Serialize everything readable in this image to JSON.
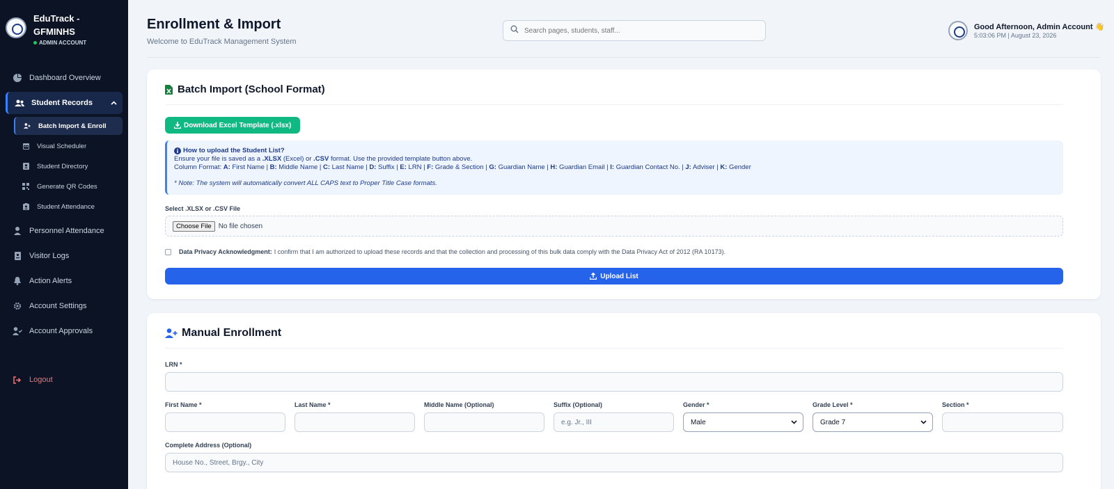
{
  "sidebar": {
    "brand_line1": "EduTrack -",
    "brand_line2": "GFMINHS",
    "role": "ADMIN ACCOUNT",
    "items": {
      "dashboard": "Dashboard Overview",
      "student_records": "Student Records",
      "personnel": "Personnel Attendance",
      "visitor": "Visitor Logs",
      "alerts": "Action Alerts",
      "settings": "Account Settings",
      "approvals": "Account Approvals",
      "logout": "Logout"
    },
    "sub_items": {
      "batch": "Batch Import & Enroll",
      "scheduler": "Visual Scheduler",
      "directory": "Student Directory",
      "qr": "Generate QR Codes",
      "attendance": "Student Attendance"
    }
  },
  "header": {
    "title": "Enrollment & Import",
    "subtitle": "Welcome to EduTrack Management System",
    "search_placeholder": "Search pages, students, staff...",
    "greeting": "Good Afternoon, Admin Account 👋",
    "datetime": "5:03:06 PM | August 23, 2026"
  },
  "batch": {
    "title": "Batch Import (School Format)",
    "download_label": "Download Excel Template (.xlsx)",
    "info_heading": "How to upload the Student List?",
    "info_line1_a": "Ensure your file is saved as a ",
    "info_line1_xlsx": ".XLSX",
    "info_line1_b": " (Excel) or ",
    "info_line1_csv": ".CSV",
    "info_line1_c": " format. Use the provided template button above.",
    "column_format": [
      {
        "key": "A:",
        "val": "First Name"
      },
      {
        "key": "B:",
        "val": "Middle Name"
      },
      {
        "key": "C:",
        "val": "Last Name"
      },
      {
        "key": "D:",
        "val": "Suffix"
      },
      {
        "key": "E:",
        "val": "LRN"
      },
      {
        "key": "F:",
        "val": "Grade & Section"
      },
      {
        "key": "G:",
        "val": "Guardian Name"
      },
      {
        "key": "H:",
        "val": "Guardian Email"
      },
      {
        "key": "I:",
        "val": "Guardian Contact No."
      },
      {
        "key": "J:",
        "val": "Adviser"
      },
      {
        "key": "K:",
        "val": "Gender"
      }
    ],
    "column_format_prefix": "Column Format:",
    "note": "* Note: The system will automatically convert ALL CAPS text to Proper Title Case formats.",
    "file_label": "Select .XLSX or .CSV File",
    "choose_file": "Choose File",
    "no_file": "No file chosen",
    "privacy_bold": "Data Privacy Acknowledgment:",
    "privacy_text": "I confirm that I am authorized to upload these records and that the collection and processing of this bulk data comply with the Data Privacy Act of 2012 (RA 10173).",
    "upload_label": "Upload List"
  },
  "manual": {
    "title": "Manual Enrollment",
    "lrn_label": "LRN *",
    "first_name_label": "First Name *",
    "last_name_label": "Last Name *",
    "middle_name_label": "Middle Name (Optional)",
    "suffix_label": "Suffix (Optional)",
    "suffix_placeholder": "e.g. Jr., III",
    "gender_label": "Gender *",
    "gender_value": "Male",
    "grade_label": "Grade Level *",
    "grade_value": "Grade 7",
    "section_label": "Section *",
    "address_label": "Complete Address (Optional)",
    "address_placeholder": "House No., Street, Brgy., City"
  }
}
